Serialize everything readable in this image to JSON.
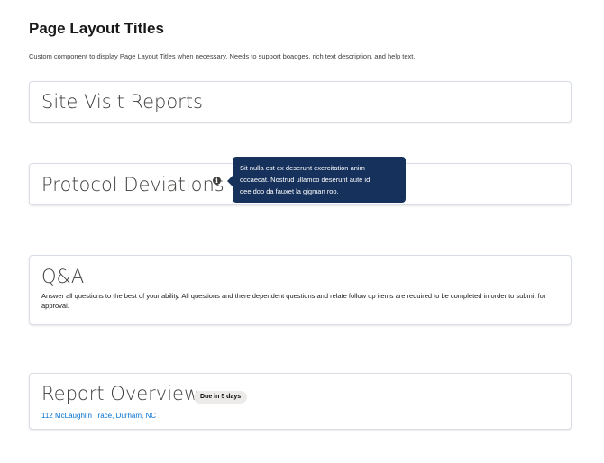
{
  "page": {
    "title": "Page Layout Titles",
    "description": "Custom component to display Page Layout Titles when necessary. Needs to support boadges, rich text description, and help text."
  },
  "cards": {
    "site_visit": {
      "title": "Site Visit Reports"
    },
    "protocol": {
      "title": "Protocol Deviations",
      "help_icon": "info-icon",
      "tooltip_lines": [
        "Sit nulla est ex deserunt exercitation anim",
        "occaecat. Nostrud ullamco deserunt aute id",
        "dee doo da fauxet la gigman roo."
      ]
    },
    "qa": {
      "title": "Q&A",
      "description": "Answer all questions to the best of your ability. All questions and there dependent questions and relate follow up items are required to be completed in order to submit for approval."
    },
    "report": {
      "title": "Report Overview",
      "badge": "Due in 5 days",
      "address": "112 McLaughlin Trace, Durham, NC"
    }
  },
  "colors": {
    "tooltip_background": "#16325c",
    "link": "#0070d2",
    "badge_background": "#ecebea",
    "card_border": "#d8dde6"
  }
}
